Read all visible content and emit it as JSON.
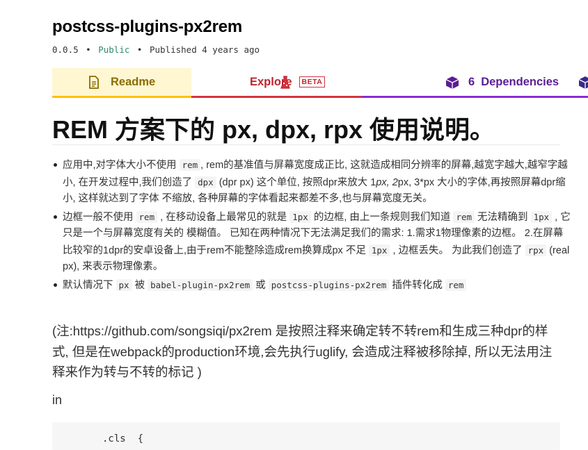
{
  "package": {
    "name": "postcss-plugins-px2rem",
    "version": "0.0.5",
    "visibility": "Public",
    "published": "Published 4 years ago",
    "separator": "•"
  },
  "tabs": [
    {
      "label": "Readme",
      "icon": "document-icon",
      "color": "#8a6d00"
    },
    {
      "label": "Explore",
      "icon": "flask-icon",
      "color": "#c0262f",
      "badge": "BETA"
    },
    {
      "label": "Dependencies",
      "icon": "cube-icon",
      "color": "#5b1d96",
      "count": "6"
    }
  ],
  "readme": {
    "title": "REM 方案下的 px, dpx, rpx 使用说明。",
    "bullet1": {
      "a": "应用中,对字体大小不使用 ",
      "code1": "rem",
      "b": ", rem的基准值与屏幕宽度成正比, 这就造成相同分辨率的屏幕,越宽字越大,越窄字越小, 在开发过程中,我们创造了 ",
      "code2": "dpx",
      "c": " (dpr px) 这个单位, 按照dpr来放大 1",
      "em1": "px, 2",
      "d": "px, 3*px 大小的字体,再按照屏幕dpr缩小, 这样就达到了字体 不缩放, 各种屏幕的字体看起来都差不多,也与屏幕宽度无关。"
    },
    "bullet2": {
      "a": "边框一般不使用 ",
      "code1": "rem",
      "b": " , 在移动设备上最常见的就是 ",
      "code2": "1px",
      "c": " 的边框, 由上一条规则我们知道 ",
      "code3": "rem",
      "d": " 无法精确到 ",
      "code4": "1px",
      "e": " , 它只是一个与屏幕宽度有关的 模糊值。 已知在两种情况下无法满足我们的需求: 1.需求1物理像素的边框。 2.在屏幕比较窄的1dpr的安卓设备上,由于rem不能整除造成rem换算成px 不足 ",
      "code5": "1px",
      "f": " , 边框丢失。 为此我们创造了 ",
      "code6": "rpx",
      "g": " (real px), 来表示物理像素。"
    },
    "bullet3": {
      "a": "默认情况下 ",
      "code1": "px",
      "b": " 被 ",
      "code2": "babel-plugin-px2rem",
      "c": " 或 ",
      "code3": "postcss-plugins-px2rem",
      "d": " 插件转化成 ",
      "code4": "rem"
    },
    "note": "(注:https://github.com/songsiqi/px2rem 是按照注释来确定转不转rem和生成三种dpr的样式, 但是在webpack的production环境,会先执行uglify, 会造成注释被移除掉, 所以无法用注释来作为转与不转的标记 )",
    "in_label": "in",
    "code_line": ".cls  {"
  }
}
